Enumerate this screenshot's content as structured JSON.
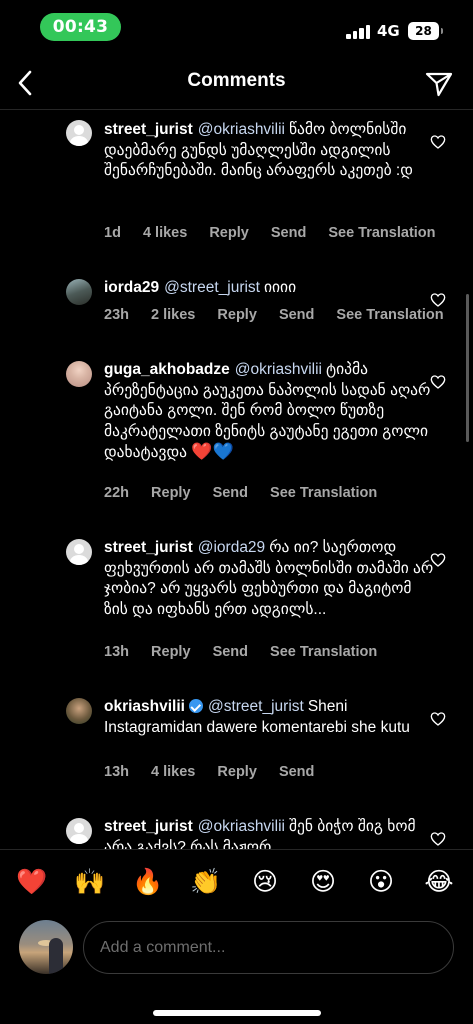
{
  "status_bar": {
    "time": "00:43",
    "network": "4G",
    "battery": "28"
  },
  "header": {
    "title": "Comments"
  },
  "comments": [
    {
      "username": "street_jurist",
      "mention": "@okriashvilii",
      "text": "წამო ბოლნისში დაებმარე გუნდს უმაღლესში ადგილის შენარჩუნებაში. მაინც არაფერს აკეთებ :დ",
      "time": "1d",
      "likes": "4 likes",
      "reply": "Reply",
      "send": "Send",
      "translate": "See Translation"
    },
    {
      "username": "iorda29",
      "mention": "@street_jurist",
      "text": "იიიი",
      "time": "23h",
      "likes": "2 likes",
      "reply": "Reply",
      "send": "Send",
      "translate": "See Translation"
    },
    {
      "username": "guga_akhobadze",
      "mention": "@okriashvilii",
      "text": "ტიპმა პრეზენტაცია გაუკეთა ნაპოლის სადან აღარ გაიტანა გოლი. შენ რომ ბოლო წუთზე მაკრატელათი ზენიტს გაუტანე ეგეთი გოლი დახატავდა",
      "emojis": "❤️💙",
      "time": "22h",
      "reply": "Reply",
      "send": "Send",
      "translate": "See Translation"
    },
    {
      "username": "street_jurist",
      "mention": "@iorda29",
      "text": "რა იი? საერთოდ ფეხვურთის არ თამაშს ბოლნისში თამაში არ ჯობია? არ უყვარს ფეხბურთი და მაგიტომ ზის და იფხანს ერთ ადგილს...",
      "time": "13h",
      "reply": "Reply",
      "send": "Send",
      "translate": "See Translation"
    },
    {
      "username": "okriashvilii",
      "mention": "@street_jurist",
      "text": "Sheni Instagramidan dawere komentarebi she kutu",
      "time": "13h",
      "likes": "4 likes",
      "reply": "Reply",
      "send": "Send"
    },
    {
      "username": "street_jurist",
      "mention": "@okriashvilii",
      "text": "შენ ბიჭო შიგ ხომ არა გაქვს? რას მაჟღრ..."
    }
  ],
  "reactions": [
    "❤️",
    "🙌",
    "🔥",
    "👏",
    "😢",
    "😍",
    "😮",
    "😂"
  ],
  "input": {
    "placeholder": "Add a comment..."
  }
}
